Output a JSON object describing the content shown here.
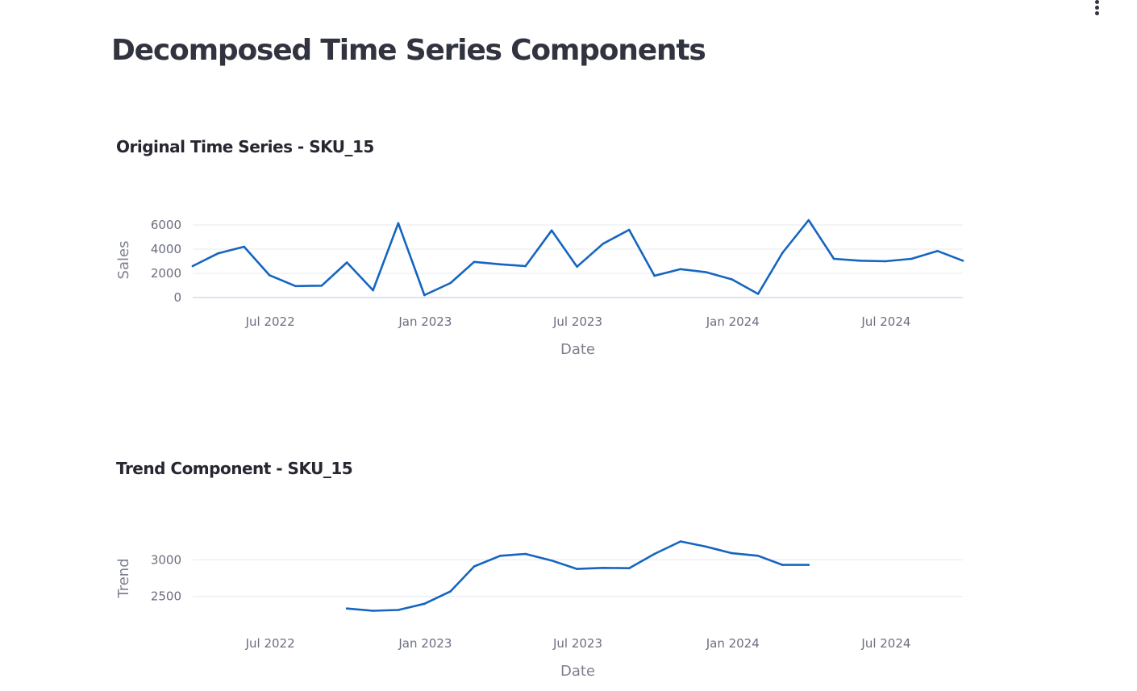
{
  "page": {
    "title": "Decomposed Time Series Components",
    "menu_icon": "kebab-menu-icon"
  },
  "colors": {
    "line": "#1565c0",
    "grid": "#e6e8ee",
    "zero_line": "#dde3f0"
  },
  "chart_data": [
    {
      "type": "line",
      "title": "Original Time Series - SKU_15",
      "xlabel": "Date",
      "ylabel": "Sales",
      "x_ticks": [
        "Jul 2022",
        "Jan 2023",
        "Jul 2023",
        "Jan 2024",
        "Jul 2024"
      ],
      "y_ticks": [
        0,
        2000,
        4000,
        6000
      ],
      "xlim": [
        "2022-03-31",
        "2024-09-30"
      ],
      "ylim": [
        0,
        6200
      ],
      "grid": true,
      "series": [
        {
          "x": [
            "2022-03-31",
            "2022-04-30",
            "2022-05-31",
            "2022-06-30",
            "2022-07-31",
            "2022-08-31",
            "2022-09-30",
            "2022-10-31",
            "2022-11-30",
            "2022-12-31",
            "2023-01-31",
            "2023-02-28",
            "2023-03-31",
            "2023-04-30",
            "2023-05-31",
            "2023-06-30",
            "2023-07-31",
            "2023-08-31",
            "2023-09-30",
            "2023-10-31",
            "2023-11-30",
            "2023-12-31",
            "2024-01-31",
            "2024-02-29",
            "2024-03-31",
            "2024-04-30",
            "2024-05-31",
            "2024-06-30",
            "2024-07-31",
            "2024-08-31",
            "2024-09-30"
          ],
          "values": [
            2600,
            3650,
            4200,
            1850,
            950,
            980,
            2900,
            600,
            6150,
            200,
            1200,
            2950,
            2750,
            2600,
            5550,
            2550,
            4450,
            5600,
            1800,
            2350,
            2100,
            1500,
            300,
            3700,
            6400,
            3200,
            3050,
            3000,
            3200,
            3850,
            3050
          ]
        }
      ]
    },
    {
      "type": "line",
      "title": "Trend Component - SKU_15",
      "xlabel": "Date",
      "ylabel": "Trend",
      "x_ticks": [
        "Jul 2022",
        "Jan 2023",
        "Jul 2023",
        "Jan 2024",
        "Jul 2024"
      ],
      "y_ticks": [
        2500,
        3000
      ],
      "xlim": [
        "2022-03-31",
        "2024-09-30"
      ],
      "ylim": [
        2200,
        3300
      ],
      "grid": true,
      "series": [
        {
          "x": [
            "2022-09-30",
            "2022-10-31",
            "2022-11-30",
            "2022-12-31",
            "2023-01-31",
            "2023-02-28",
            "2023-03-31",
            "2023-04-30",
            "2023-05-31",
            "2023-06-30",
            "2023-07-31",
            "2023-08-31",
            "2023-09-30",
            "2023-10-31",
            "2023-11-30",
            "2023-12-31",
            "2024-01-31",
            "2024-02-29",
            "2024-03-31"
          ],
          "values": [
            2335,
            2305,
            2315,
            2400,
            2570,
            2910,
            3055,
            3080,
            2990,
            2875,
            2890,
            2885,
            3080,
            3250,
            3180,
            3090,
            3055,
            2930,
            2930
          ]
        }
      ]
    }
  ]
}
